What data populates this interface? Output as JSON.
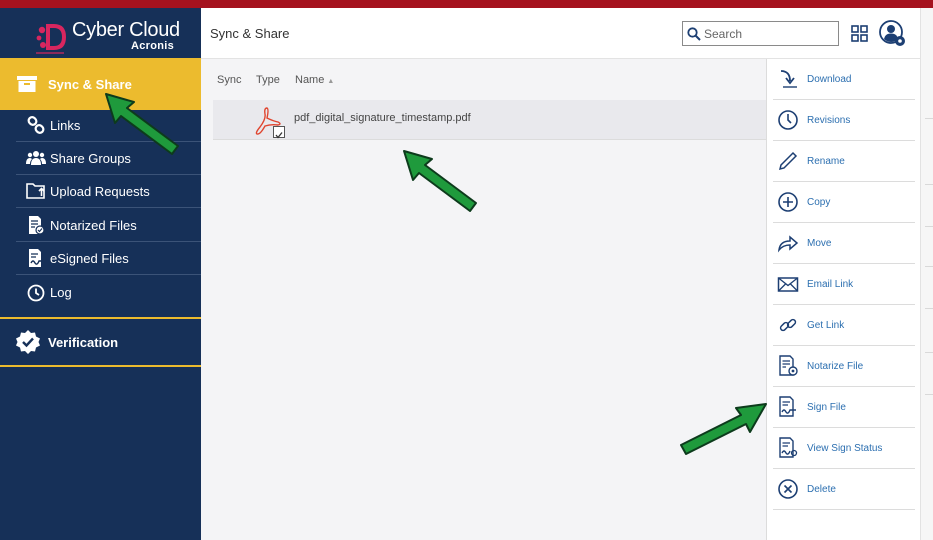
{
  "app": {
    "brand": "Cyber Cloud",
    "sub_brand": "Acronis"
  },
  "colors": {
    "top_bar": "#a5121e",
    "sidebar_bg": "#163058",
    "accent_yellow": "#ecbb2e",
    "link_blue": "#2c6fb0",
    "arrow_green": "#1f9a3c"
  },
  "sidebar": {
    "main_item": {
      "label": "Sync & Share",
      "icon": "archive-box-icon"
    },
    "items": [
      {
        "label": "Links",
        "icon": "link-icon"
      },
      {
        "label": "Share Groups",
        "icon": "group-icon"
      },
      {
        "label": "Upload Requests",
        "icon": "folder-upload-icon"
      },
      {
        "label": "Notarized Files",
        "icon": "notarized-file-icon"
      },
      {
        "label": "eSigned Files",
        "icon": "esigned-file-icon"
      },
      {
        "label": "Log",
        "icon": "clock-icon"
      }
    ],
    "verification": {
      "label": "Verification",
      "icon": "verified-badge-icon"
    }
  },
  "header": {
    "title": "Sync & Share",
    "search": {
      "placeholder": "Search",
      "value": ""
    },
    "grid_icon": "grid-icon",
    "user_icon": "user-settings-icon"
  },
  "file_list": {
    "columns": [
      "Sync",
      "Type",
      "Name"
    ],
    "sort_column": "Name",
    "rows": [
      {
        "name": "pdf_digital_signature_timestamp.pdf",
        "type_icon": "pdf-icon",
        "selected": true
      }
    ]
  },
  "actions": [
    {
      "label": "Download",
      "icon": "download-icon"
    },
    {
      "label": "Revisions",
      "icon": "revisions-clock-icon"
    },
    {
      "label": "Rename",
      "icon": "pencil-icon"
    },
    {
      "label": "Copy",
      "icon": "plus-circle-icon"
    },
    {
      "label": "Move",
      "icon": "move-arrow-icon"
    },
    {
      "label": "Email Link",
      "icon": "envelope-icon"
    },
    {
      "label": "Get Link",
      "icon": "chain-link-icon"
    },
    {
      "label": "Notarize File",
      "icon": "notarize-icon"
    },
    {
      "label": "Sign File",
      "icon": "sign-file-icon"
    },
    {
      "label": "View Sign Status",
      "icon": "sign-status-icon"
    },
    {
      "label": "Delete",
      "icon": "delete-x-icon"
    }
  ]
}
